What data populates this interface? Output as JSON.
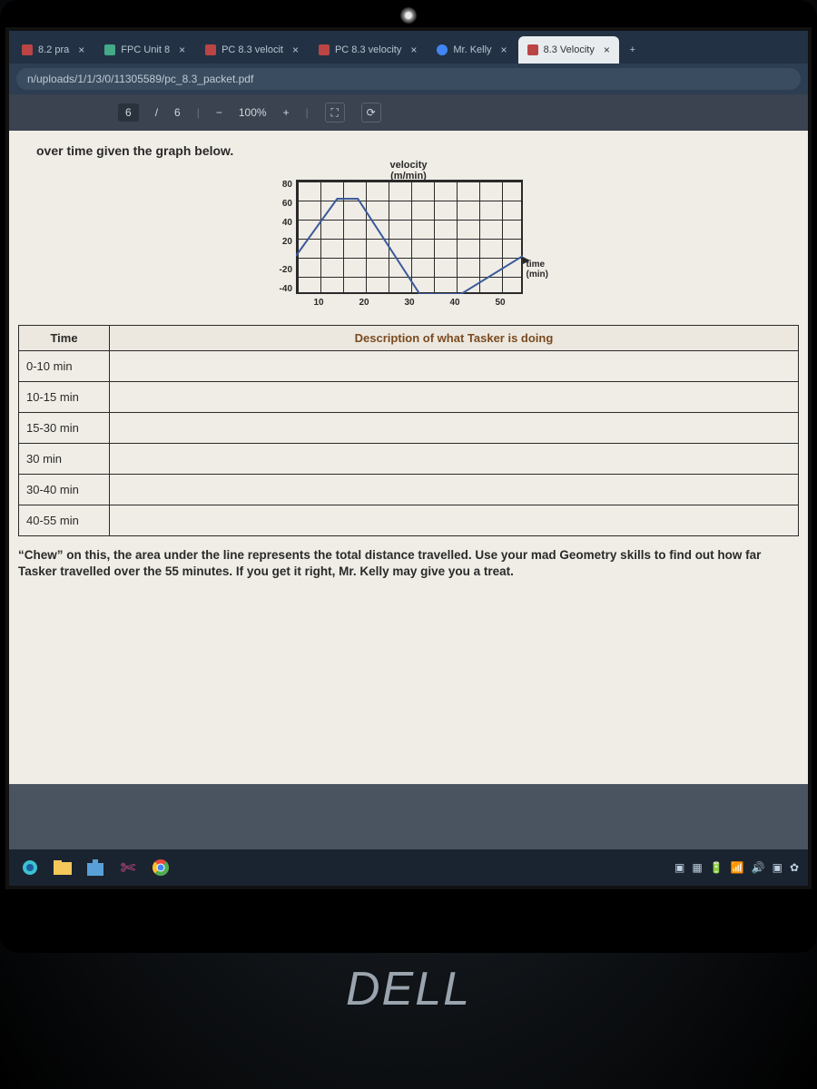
{
  "browser": {
    "tabs": [
      {
        "label": "8.2 pra",
        "active": false
      },
      {
        "label": "FPC Unit 8",
        "active": false
      },
      {
        "label": "PC 8.3 velocit",
        "active": false
      },
      {
        "label": "PC 8.3 velocity",
        "active": false
      },
      {
        "label": "Mr. Kelly",
        "active": false
      },
      {
        "label": "8.3 Velocity",
        "active": true
      }
    ],
    "url": "n/uploads/1/1/3/0/11305589/pc_8.3_packet.pdf"
  },
  "pdf_toolbar": {
    "page_current": "6",
    "page_sep": "/",
    "page_total": "6",
    "minus": "−",
    "zoom": "100%",
    "plus": "+"
  },
  "document": {
    "over_title": "over time given the graph below.",
    "table": {
      "headers": [
        "Time",
        "Description of what Tasker is doing"
      ],
      "rows": [
        "0-10 min",
        "10-15 min",
        "15-30 min",
        "30 min",
        "30-40 min",
        "40-55 min"
      ]
    },
    "chew": "“Chew” on this, the area under the line represents the total distance travelled.  Use your mad Geometry skills to find out how far Tasker travelled over the 55 minutes.  If you get it right, Mr. Kelly may give you a treat."
  },
  "chart_data": {
    "type": "line",
    "title": "",
    "ylabel_line1": "velocity",
    "ylabel_line2": "(m/min)",
    "xlabel_line1": "time",
    "xlabel_line2": "(min)",
    "yticks": [
      "80",
      "60",
      "40",
      "20",
      "",
      "-20",
      "-40"
    ],
    "xticks": [
      "10",
      "20",
      "30",
      "40",
      "50"
    ],
    "ylim": [
      -40,
      80
    ],
    "xlim": [
      0,
      55
    ],
    "x": [
      0,
      10,
      15,
      30,
      40,
      55
    ],
    "y": [
      0,
      60,
      60,
      -40,
      -40,
      0
    ]
  },
  "logo": "DELL"
}
